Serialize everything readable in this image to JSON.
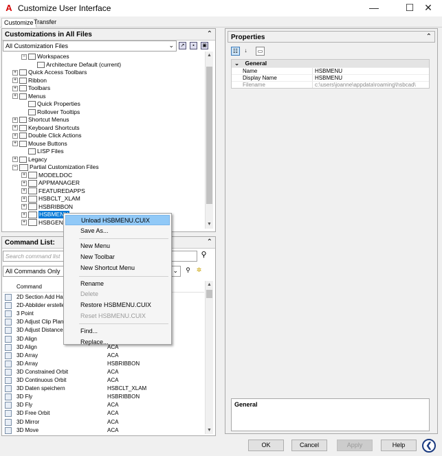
{
  "window": {
    "title": "Customize User Interface",
    "minimize": "—",
    "maximize": "☐",
    "close": "✕"
  },
  "tabs": [
    "Customize",
    "Transfer"
  ],
  "customizations_panel": {
    "header": "Customizations in All Files",
    "collapse": "⌃",
    "combo_value": "All Customization Files",
    "tree": [
      {
        "label": "Workspaces",
        "level": 1,
        "expander": "−",
        "icon": "workspaces-icon"
      },
      {
        "label": "Architecture Default (current)",
        "level": 2,
        "expander": "",
        "icon": "workspace-gear-icon"
      },
      {
        "label": "Quick Access Toolbars",
        "level": 0,
        "expander": "+",
        "icon": "toolbar-icon"
      },
      {
        "label": "Ribbon",
        "level": 0,
        "expander": "+",
        "icon": "ribbon-icon"
      },
      {
        "label": "Toolbars",
        "level": 0,
        "expander": "+",
        "icon": "toolbar-icon"
      },
      {
        "label": "Menus",
        "level": 0,
        "expander": "+",
        "icon": "menus-icon"
      },
      {
        "label": "Quick Properties",
        "level": 1,
        "expander": "",
        "icon": "properties-icon"
      },
      {
        "label": "Rollover Tooltips",
        "level": 1,
        "expander": "",
        "icon": "tooltip-icon"
      },
      {
        "label": "Shortcut Menus",
        "level": 0,
        "expander": "+",
        "icon": "shortcut-menu-icon"
      },
      {
        "label": "Keyboard Shortcuts",
        "level": 0,
        "expander": "+",
        "icon": "keyboard-icon"
      },
      {
        "label": "Double Click Actions",
        "level": 0,
        "expander": "+",
        "icon": "mouse-icon"
      },
      {
        "label": "Mouse Buttons",
        "level": 0,
        "expander": "+",
        "icon": "mouse-icon"
      },
      {
        "label": "LISP Files",
        "level": 1,
        "expander": "",
        "icon": "lisp-icon"
      },
      {
        "label": "Legacy",
        "level": 0,
        "expander": "+",
        "icon": "legacy-icon"
      },
      {
        "label": "Partial Customization Files",
        "level": 0,
        "expander": "−",
        "icon": "cui-icon"
      },
      {
        "label": "MODELDOC",
        "level": 1,
        "expander": "+",
        "icon": "cui-icon"
      },
      {
        "label": "APPMANAGER",
        "level": 1,
        "expander": "+",
        "icon": "cui-icon"
      },
      {
        "label": "FEATUREDAPPS",
        "level": 1,
        "expander": "+",
        "icon": "cui-icon"
      },
      {
        "label": "HSBCLT_XLAM",
        "level": 1,
        "expander": "+",
        "icon": "cui-icon"
      },
      {
        "label": "HSBRIBBON",
        "level": 1,
        "expander": "+",
        "icon": "cui-icon"
      },
      {
        "label": "HSBMENU",
        "level": 1,
        "expander": "+",
        "icon": "cui-icon",
        "selected": true
      },
      {
        "label": "HSBGEN",
        "level": 1,
        "expander": "+",
        "icon": "cui-icon"
      }
    ]
  },
  "command_panel": {
    "header": "Command List:",
    "collapse": "⌃",
    "search_placeholder": "Search command list",
    "filter_value": "All Commands Only",
    "column_command": "Command",
    "rows": [
      {
        "name": "2D Section Add Hat",
        "source": ""
      },
      {
        "name": "2D-Abbilder erstellen",
        "source": ""
      },
      {
        "name": "3 Point",
        "source": ""
      },
      {
        "name": "3D Adjust Clip Plane",
        "source": ""
      },
      {
        "name": "3D Adjust Distance",
        "source": ""
      },
      {
        "name": "3D Align",
        "source": ""
      },
      {
        "name": "3D Align",
        "source": "ACA"
      },
      {
        "name": "3D Array",
        "source": "ACA"
      },
      {
        "name": "3D Array",
        "source": "HSBRIBBON"
      },
      {
        "name": "3D Constrained Orbit",
        "source": "ACA"
      },
      {
        "name": "3D Continuous Orbit",
        "source": "ACA"
      },
      {
        "name": "3D Daten speichern",
        "source": "HSBCLT_XLAM"
      },
      {
        "name": "3D Fly",
        "source": "HSBRIBBON"
      },
      {
        "name": "3D Fly",
        "source": "ACA"
      },
      {
        "name": "3D Free Orbit",
        "source": "ACA"
      },
      {
        "name": "3D Mirror",
        "source": "ACA"
      },
      {
        "name": "3D Move",
        "source": "ACA"
      }
    ]
  },
  "properties_panel": {
    "header": "Properties",
    "collapse": "⌃",
    "category": "General",
    "rows": [
      {
        "key": "Name",
        "value": "HSBMENU",
        "disabled": false
      },
      {
        "key": "Display Name",
        "value": "HSBMENU",
        "disabled": false
      },
      {
        "key": "Filename",
        "value": "c:\\users\\joanne\\appdata\\roaming\\hsbcad\\",
        "disabled": true
      }
    ],
    "description_header": "General"
  },
  "context_menu": {
    "items": [
      {
        "label": "Unload HSBMENU.CUIX",
        "highlighted": true,
        "disabled": false
      },
      {
        "label": "Save As...",
        "highlighted": false,
        "disabled": false
      },
      {
        "sep": true
      },
      {
        "label": "New Menu",
        "highlighted": false,
        "disabled": false
      },
      {
        "label": "New Toolbar",
        "highlighted": false,
        "disabled": false
      },
      {
        "label": "New Shortcut Menu",
        "highlighted": false,
        "disabled": false
      },
      {
        "sep": true
      },
      {
        "label": "Rename",
        "highlighted": false,
        "disabled": false
      },
      {
        "label": "Delete",
        "highlighted": false,
        "disabled": true
      },
      {
        "label": "Restore HSBMENU.CUIX",
        "highlighted": false,
        "disabled": false
      },
      {
        "label": "Reset HSBMENU.CUIX",
        "highlighted": false,
        "disabled": true
      },
      {
        "sep": true
      },
      {
        "label": "Find...",
        "highlighted": false,
        "disabled": false
      },
      {
        "label": "Replace...",
        "highlighted": false,
        "disabled": false
      }
    ]
  },
  "buttons": {
    "ok": "OK",
    "cancel": "Cancel",
    "apply": "Apply",
    "help": "Help",
    "nav": "❮"
  }
}
